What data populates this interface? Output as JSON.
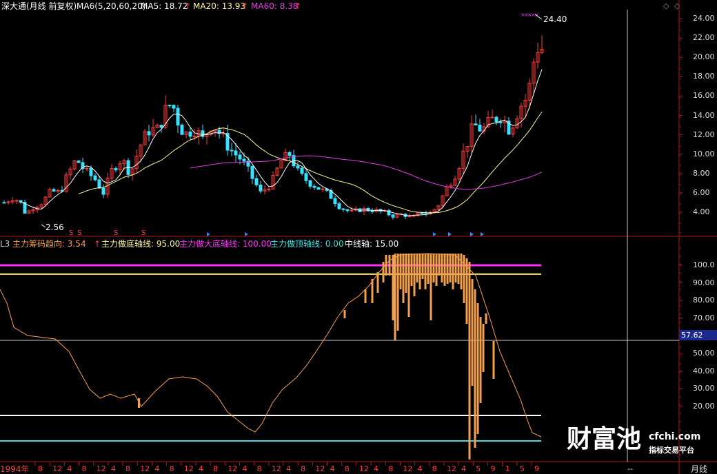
{
  "header": {
    "title": "深大通(月线 前复权)",
    "ma_params": "MA6(5,20,60,20)",
    "ma5": "MA5: 18.72",
    "ma20": "MA20: 13.93",
    "ma60": "MA60: 8.38",
    "up_arrow": "↑"
  },
  "indicator_header": {
    "prefix": "L3",
    "trend": "主力筹码趋向: 3.54",
    "bottom": "主力做底轴线: 95.00",
    "big_bottom": "主力做大底轴线: 100.00",
    "top": "主力做顶轴线: 0.00",
    "mid": "中线轴: 15.00"
  },
  "annotations": {
    "high_price": "24.40",
    "low_price": "2.56",
    "s_marker": "S"
  },
  "price_axis": [
    "24.00",
    "22.00",
    "20.00",
    "18.00",
    "16.00",
    "14.00",
    "12.00",
    "10.00",
    "8.00",
    "6.00",
    "4.00"
  ],
  "indicator_axis": [
    "100.0",
    "90.00",
    "80.00",
    "70.00",
    "60.00",
    "50.00",
    "40.00",
    "30.00",
    "20.00"
  ],
  "current_value": "57.62",
  "time_axis": {
    "start_label": "1994年",
    "labels": [
      "8",
      "12",
      "4",
      "8",
      "12",
      "4",
      "8",
      "12",
      "4",
      "8",
      "12",
      "4",
      "8",
      "12",
      "4",
      "8",
      "12",
      "4",
      "8",
      "12",
      "4",
      "8",
      "12",
      "4",
      "8",
      "12",
      "4",
      "8",
      "12",
      "4",
      "5",
      "9",
      "1",
      "5",
      "9"
    ],
    "period": "月线",
    "end_marker": "--"
  },
  "watermark": {
    "brand": "财富池",
    "site": "cfchi.com",
    "tagline": "指标交易平台"
  },
  "colors": {
    "up": "#ff3b3b",
    "down": "#3ae0ff",
    "ma5": "#ffffff",
    "ma20": "#fff59d",
    "ma60": "#e040e0",
    "bar": "#f5a050",
    "magenta": "#ff30ff",
    "yellow": "#ffff80",
    "cyan": "#40e0e0",
    "divider": "#b01818"
  }
}
